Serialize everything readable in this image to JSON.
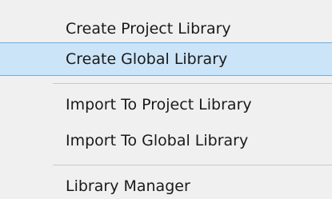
{
  "menu": {
    "items": [
      {
        "label": "Create Project Library"
      },
      {
        "label": "Create Global Library"
      },
      {
        "label": "Import To Project Library"
      },
      {
        "label": "Import To Global Library"
      },
      {
        "label": "Library Manager"
      }
    ],
    "highlighted_item": "Create Global Library",
    "colors": {
      "background": "#f0f0f0",
      "highlight_fill": "#cce4f7",
      "highlight_border": "#6aaee2",
      "text": "#1a1a1a",
      "separator": "#c8c8c8"
    }
  }
}
